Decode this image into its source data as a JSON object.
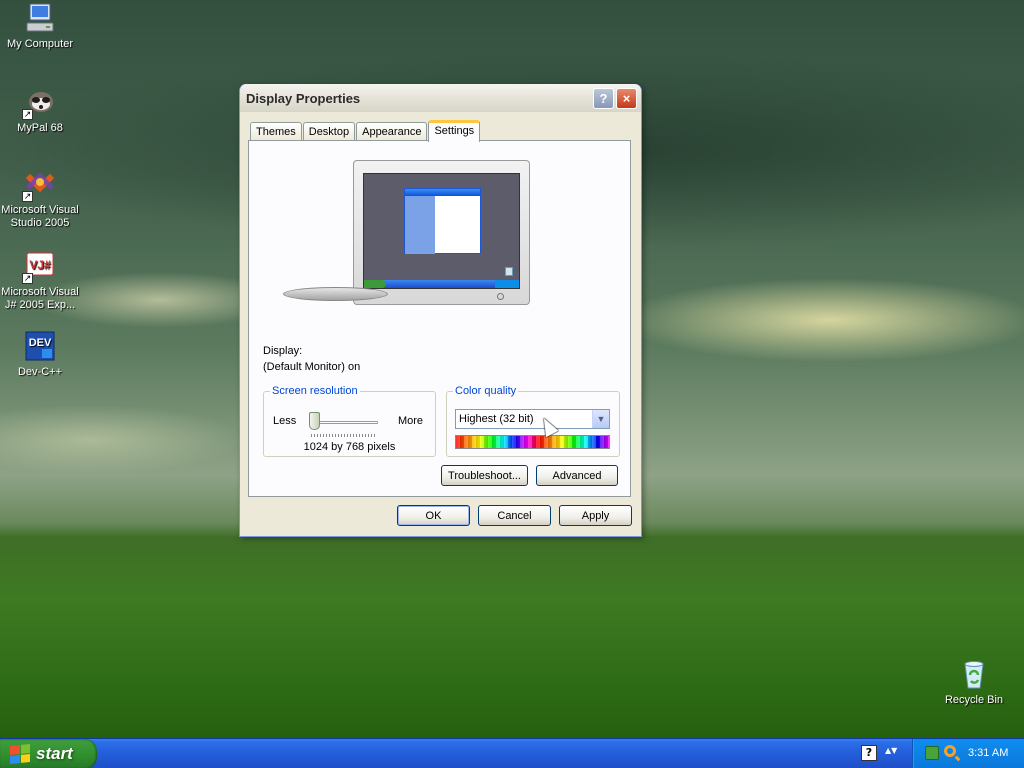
{
  "desktop": {
    "icons": [
      {
        "label": "My Computer"
      },
      {
        "label": "MyPal 68"
      },
      {
        "label": "Microsoft Visual Studio 2005"
      },
      {
        "label": "Microsoft Visual J# 2005 Exp..."
      },
      {
        "label": "Dev-C++"
      },
      {
        "label": "Recycle Bin"
      }
    ]
  },
  "dialog": {
    "title": "Display Properties",
    "help_glyph": "?",
    "close_glyph": "×",
    "tabs": [
      {
        "label": "Themes"
      },
      {
        "label": "Desktop"
      },
      {
        "label": "Appearance"
      },
      {
        "label": "Settings",
        "active": true
      }
    ],
    "display_label": "Display:",
    "display_value": "(Default Monitor) on",
    "screen_resolution": {
      "legend": "Screen resolution",
      "less_label": "Less",
      "more_label": "More",
      "value_text": "1024 by 768 pixels",
      "slider_position": 0.0
    },
    "color_quality": {
      "legend": "Color quality",
      "selected": "Highest (32 bit)",
      "dropdown_glyph": "▼"
    },
    "buttons": {
      "troubleshoot": "Troubleshoot...",
      "advanced": "Advanced",
      "ok": "OK",
      "cancel": "Cancel",
      "apply": "Apply"
    }
  },
  "taskbar": {
    "start_label": "start",
    "lang_glyph": "?",
    "chevron_glyph": "▲▼",
    "clock": "3:31 AM"
  },
  "colors": {
    "taskbar_blue": "#245edb",
    "start_green": "#3c9a3a",
    "tray_blue": "#0f8df0",
    "dialog_face": "#ece9d8",
    "active_tab_accent": "#ffc83c",
    "group_legend": "#0046d5"
  },
  "icons": [
    "my-computer-icon",
    "mypal-icon",
    "visual-studio-icon",
    "visual-jsharp-icon",
    "dev-cpp-icon",
    "recycle-bin-icon",
    "help-icon",
    "close-icon",
    "windows-flag-icon",
    "language-bar-icon",
    "tray-network-icon",
    "tray-search-icon"
  ]
}
